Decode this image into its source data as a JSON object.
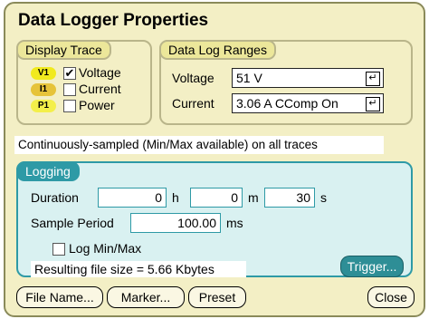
{
  "title": "Data Logger Properties",
  "display_trace": {
    "label": "Display Trace",
    "items": [
      {
        "tag": "V1",
        "label": "Voltage",
        "checked": true,
        "check_mark": "✔",
        "tag_color": "#f1ea1e"
      },
      {
        "tag": "I1",
        "label": "Current",
        "checked": false,
        "check_mark": "",
        "tag_color": "#e6c33a"
      },
      {
        "tag": "P1",
        "label": "Power",
        "checked": false,
        "check_mark": "",
        "tag_color": "#f3ef4a"
      }
    ]
  },
  "ranges": {
    "label": "Data Log Ranges",
    "voltage_label": "Voltage",
    "voltage_value": "51 V",
    "current_label": "Current",
    "current_value": "3.06 A CComp On",
    "enter_icon": "↵"
  },
  "status_text": "Continuously-sampled (Min/Max available)  on all traces",
  "logging": {
    "label": "Logging",
    "duration_label": "Duration",
    "hours": "0",
    "hours_unit": "h",
    "minutes": "0",
    "minutes_unit": "m",
    "seconds": "30",
    "seconds_unit": "s",
    "sample_period_label": "Sample Period",
    "sample_period": "100.00",
    "sample_period_unit": "ms",
    "log_minmax_label": "Log Min/Max",
    "file_size_text": "Resulting file size = 5.66 Kbytes",
    "trigger_label": "Trigger..."
  },
  "buttons": {
    "file_name": "File Name...",
    "marker": "Marker...",
    "preset": "Preset",
    "close": "Close"
  },
  "colors": {
    "window_bg": "#f3efc5",
    "logging_bg": "#d9f1f1",
    "logging_accent": "#2e9aa6",
    "trigger_bg": "#2e8e96"
  }
}
